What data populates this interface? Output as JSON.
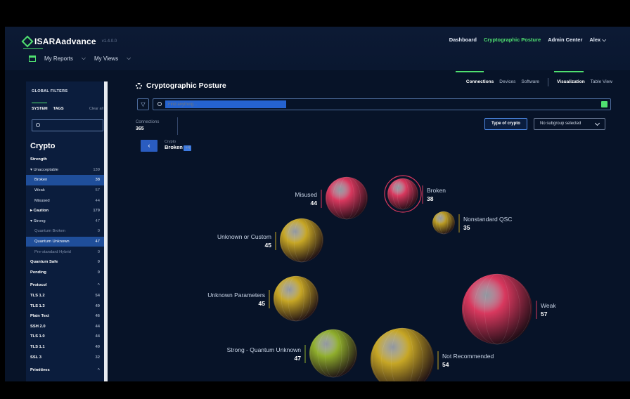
{
  "app": {
    "brand": "ISARAadvance",
    "version": "v1.4.0.0"
  },
  "topnav": {
    "dashboard": "Dashboard",
    "crypto_posture": "Cryptographic Posture",
    "admin": "Admin Center",
    "user": "Alex"
  },
  "subnav": {
    "reports": "My Reports",
    "views": "My Views"
  },
  "sidebar": {
    "header": "GLOBAL FILTERS",
    "tab_system": "SYSTEM",
    "tab_tags": "TAGS",
    "clear": "Clear all",
    "section_title": "Crypto",
    "rows": [
      {
        "label": "Strength",
        "value": "",
        "style": "bold"
      },
      {
        "label": "▾ Unacceptable",
        "value": "139",
        "style": ""
      },
      {
        "label": "Broken",
        "value": "38",
        "style": "sel ind"
      },
      {
        "label": "Weak",
        "value": "57",
        "style": "ind"
      },
      {
        "label": "Misused",
        "value": "44",
        "style": "ind"
      },
      {
        "label": "▸ Caution",
        "value": "179",
        "style": "bold"
      },
      {
        "label": "▾ Strong",
        "value": "47",
        "style": ""
      },
      {
        "label": "Quantum Broken",
        "value": "0",
        "style": "dim ind"
      },
      {
        "label": "Quantum Unknown",
        "value": "47",
        "style": "sel ind"
      },
      {
        "label": "Pre-standard Hybrid",
        "value": "0",
        "style": "dim ind"
      },
      {
        "label": "Quantum Safe",
        "value": "0",
        "style": "bold"
      },
      {
        "label": "Pending",
        "value": "0",
        "style": "bold"
      },
      {
        "label": "Protocol",
        "value": "^",
        "style": "bold section"
      },
      {
        "label": "TLS 1.2",
        "value": "54",
        "style": "bold"
      },
      {
        "label": "TLS 1.3",
        "value": "49",
        "style": "bold"
      },
      {
        "label": "Plain Text",
        "value": "46",
        "style": "bold"
      },
      {
        "label": "SSH 2.0",
        "value": "44",
        "style": "bold"
      },
      {
        "label": "TLS 1.0",
        "value": "44",
        "style": "bold"
      },
      {
        "label": "TLS 1.1",
        "value": "40",
        "style": "bold"
      },
      {
        "label": "SSL 3",
        "value": "32",
        "style": "bold"
      },
      {
        "label": "Primitives",
        "value": "^",
        "style": "bold section"
      }
    ]
  },
  "main": {
    "title": "Cryptographic Posture",
    "tabs": [
      "Connections",
      "Devices",
      "Software"
    ],
    "view_tabs": [
      "Visualization",
      "Table View"
    ],
    "search_placeholder": "Find anything...",
    "connections_label": "Connections",
    "connections_count": "365",
    "type_button": "Type of crypto",
    "subgroup_button": "No subgroup selected",
    "crumb_label": "Crypto",
    "crumb_value": "Broken",
    "crumb_badge": "+4"
  },
  "bubbles": [
    {
      "name": "Misused",
      "count": 44,
      "color": "#d8385e",
      "selected": false
    },
    {
      "name": "Broken",
      "count": 38,
      "color": "#d8385e",
      "selected": true
    },
    {
      "name": "Nonstandard QSC",
      "count": 35,
      "color": "#b89a22",
      "selected": false
    },
    {
      "name": "Unknown or Custom",
      "count": 45,
      "color": "#c6a625",
      "selected": false
    },
    {
      "name": "Unknown Parameters",
      "count": 45,
      "color": "#c6a625",
      "selected": false
    },
    {
      "name": "Weak",
      "count": 57,
      "color": "#d8385e",
      "selected": false
    },
    {
      "name": "Strong - Quantum Unknown",
      "count": 47,
      "color": "#8fae2c",
      "selected": false
    },
    {
      "name": "Not Recommended",
      "count": 54,
      "color": "#c6a625",
      "selected": false
    }
  ]
}
